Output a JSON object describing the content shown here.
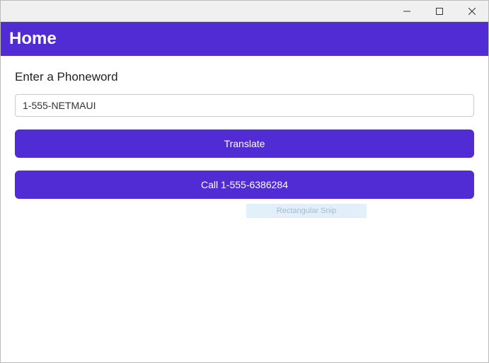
{
  "titlebar": {
    "minimize_aria": "Minimize",
    "maximize_aria": "Maximize",
    "close_aria": "Close"
  },
  "header": {
    "title": "Home"
  },
  "main": {
    "label": "Enter a Phoneword",
    "phoneword_value": "1-555-NETMAUI",
    "translate_button": "Translate",
    "call_button": "Call 1-555-6386284"
  },
  "overlay": {
    "snip_hint": "Rectangular Snip"
  },
  "colors": {
    "accent": "#512bd4"
  }
}
